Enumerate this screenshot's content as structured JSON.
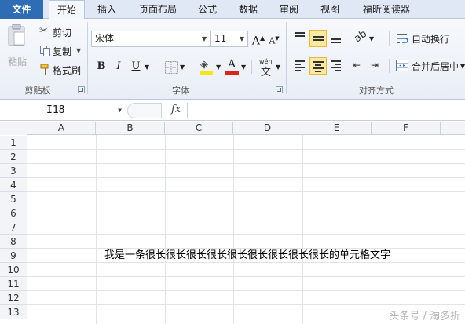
{
  "ribbon_tabs": [
    {
      "label": "文件"
    },
    {
      "label": "开始"
    },
    {
      "label": "插入"
    },
    {
      "label": "页面布局"
    },
    {
      "label": "公式"
    },
    {
      "label": "数据"
    },
    {
      "label": "审阅"
    },
    {
      "label": "视图"
    },
    {
      "label": "福昕阅读器"
    }
  ],
  "clipboard": {
    "paste_label": "粘贴",
    "cut_label": "剪切",
    "copy_label": "复制",
    "format_painter_label": "格式刷",
    "group_label": "剪贴板"
  },
  "font": {
    "font_name": "宋体",
    "font_size": "11",
    "bold": "B",
    "italic": "I",
    "underline": "U",
    "increase_size": "A",
    "decrease_size": "A",
    "phonetic": "wén",
    "font_color": "#d9241c",
    "fill_color": "#f5e51a",
    "group_label": "字体"
  },
  "alignment": {
    "wrap_text_label": "自动换行",
    "merge_center_label": "合并后居中",
    "group_label": "对齐方式"
  },
  "formula_bar": {
    "name_box": "I18",
    "fx_label": "fx",
    "content": ""
  },
  "sheet": {
    "columns": [
      "A",
      "B",
      "C",
      "D",
      "E",
      "F"
    ],
    "rows": [
      "1",
      "2",
      "3",
      "4",
      "5",
      "6",
      "7",
      "8",
      "9",
      "10",
      "11",
      "12",
      "13"
    ],
    "cell_text": "我是一条很长很长很长很长很长很长很长很长很长的单元格文字"
  },
  "watermark": "头条号 / 淘多折"
}
